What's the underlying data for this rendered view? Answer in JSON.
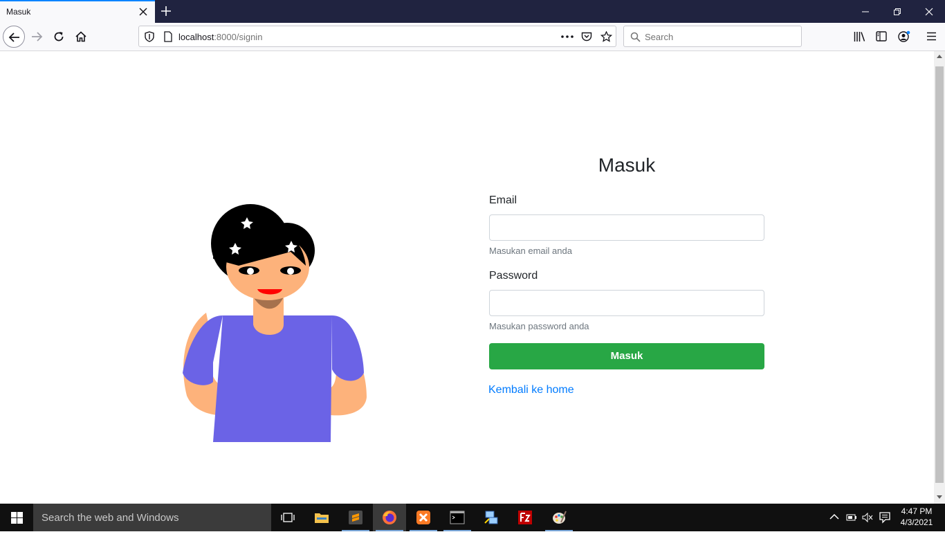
{
  "browser": {
    "tab_title": "Masuk",
    "url_host": "localhost",
    "url_rest": ":8000/signin",
    "search_placeholder": "Search"
  },
  "form": {
    "title": "Masuk",
    "email_label": "Email",
    "email_value": "",
    "email_help": "Masukan email anda",
    "password_label": "Password",
    "password_value": "",
    "password_help": "Masukan password anda",
    "submit_label": "Masuk",
    "back_link": "Kembali ke home"
  },
  "colors": {
    "submit": "#28a745",
    "link": "#007bff",
    "shirt": "#6c63e5",
    "skin": "#fdb27b"
  },
  "taskbar": {
    "search_placeholder": "Search the web and Windows",
    "time": "4:47 PM",
    "date": "4/3/2021",
    "apps": [
      "task-view-icon",
      "file-explorer-icon",
      "sublime-text-icon",
      "firefox-icon",
      "xampp-icon",
      "terminal-icon",
      "network-icon",
      "filezilla-icon",
      "paint-icon"
    ]
  }
}
